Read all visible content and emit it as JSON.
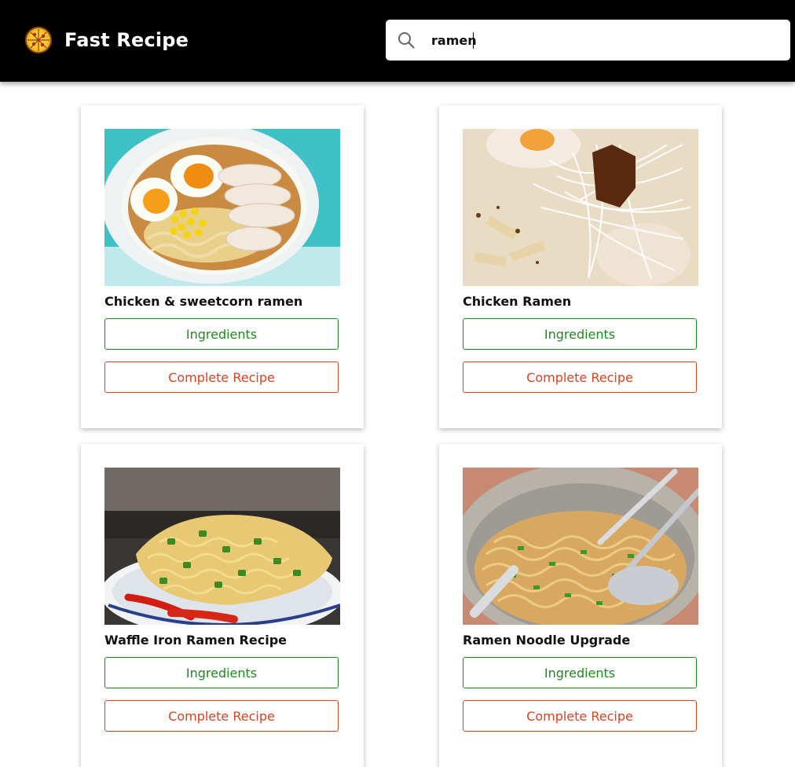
{
  "app": {
    "title": "Fast Recipe",
    "logo_icon": "pizza-icon"
  },
  "search": {
    "value": "ramen",
    "icon": "search-icon"
  },
  "colors": {
    "navbar": "#000000",
    "ingredients_button": "#1f8a1f",
    "recipe_button": "#d8431f"
  },
  "recipes": [
    {
      "title": "Chicken & sweetcorn ramen",
      "ingredients_label": "Ingredients",
      "recipe_label": "Complete Recipe"
    },
    {
      "title": "Chicken Ramen",
      "ingredients_label": "Ingredients",
      "recipe_label": "Complete Recipe"
    },
    {
      "title": "Waffle Iron Ramen Recipe",
      "ingredients_label": "Ingredients",
      "recipe_label": "Complete Recipe"
    },
    {
      "title": "Ramen Noodle Upgrade",
      "ingredients_label": "Ingredients",
      "recipe_label": "Complete Recipe"
    }
  ]
}
